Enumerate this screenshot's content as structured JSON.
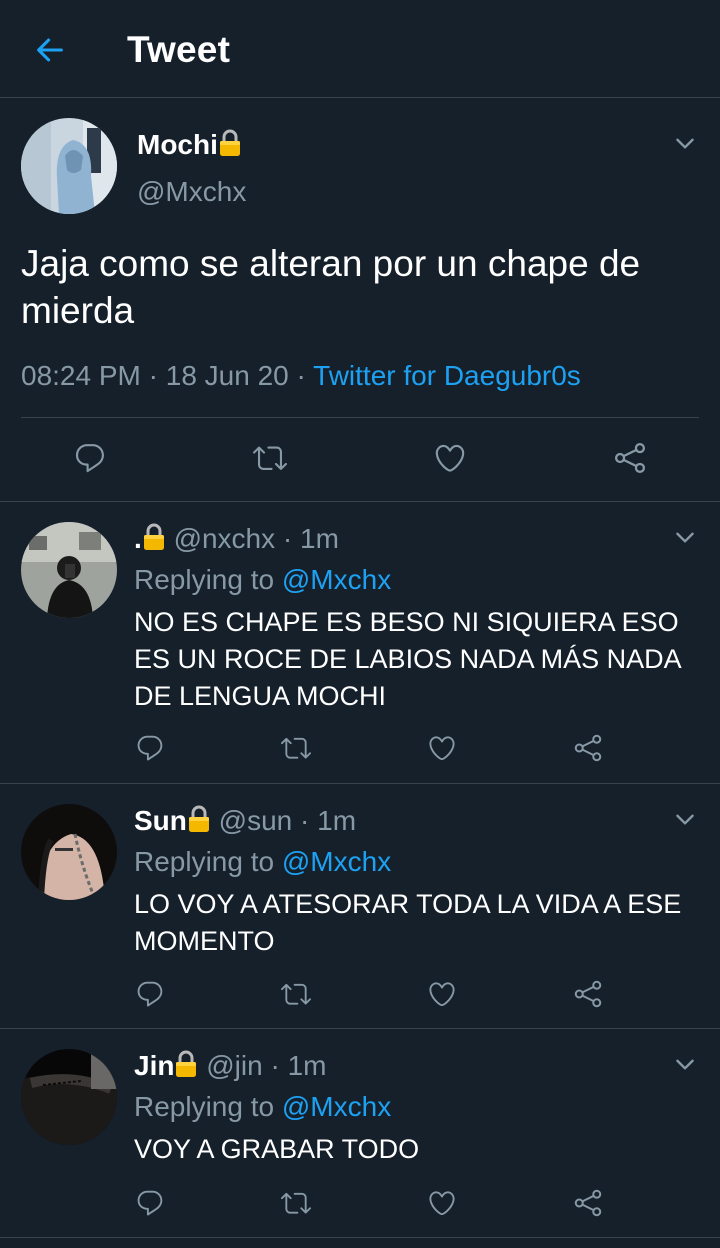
{
  "header": {
    "title": "Tweet",
    "back_icon": "arrow-left-icon"
  },
  "colors": {
    "background": "#15202b",
    "accent": "#1da1f2",
    "secondary_text": "#8899a6",
    "divider": "#38444d"
  },
  "main_tweet": {
    "name": "Mochi",
    "handle": "@Mxchx",
    "text": "Jaja como se alteran por un chape de mierda",
    "time": "08:24 PM",
    "date": "18 Jun 20",
    "separator": "·",
    "source": "Twitter for Daegubr0s"
  },
  "replies": [
    {
      "name": ".",
      "handle": "@nxchx",
      "time": "1m",
      "replying_label": "Replying to",
      "replying_to": "@Mxchx",
      "text": "NO ES CHAPE ES BESO NI SIQUIERA ESO ES UN ROCE DE LABIOS NADA MÁS NADA DE LENGUA MOCHI"
    },
    {
      "name": "Sun",
      "handle": "@sun",
      "time": "1m",
      "replying_label": "Replying to",
      "replying_to": "@Mxchx",
      "text": "LO VOY A ATESORAR TODA LA VIDA A ESE MOMENTO"
    },
    {
      "name": "Jin",
      "handle": "@jin",
      "time": "1m",
      "replying_label": "Replying to",
      "replying_to": "@Mxchx",
      "text": "VOY A GRABAR TODO"
    }
  ]
}
